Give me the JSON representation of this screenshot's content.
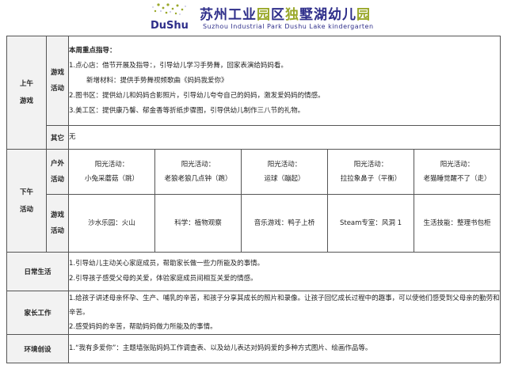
{
  "header": {
    "logo_text": "DuShu",
    "title_part1": "苏州工业",
    "title_hl1": "园",
    "title_part2": "区",
    "title_hl2": "独",
    "title_part3": "墅湖幼儿",
    "title_hl3": "园",
    "subtitle": "Suzhou Industrial Park Dushu Lake kindergarten"
  },
  "morning": {
    "label_line1": "上午",
    "label_line2": "游戏",
    "game_label_line1": "游戏",
    "game_label_line2": "活动",
    "heading": "本周重点指导：",
    "lines": [
      "1.点心店：借节开展及指导：，引导幼儿学习手势舞，回家表演给妈妈看。",
      "新增材料：提供手势舞视频歌曲《妈妈我爱你》",
      "2.图书区：提供幼儿和妈妈合影照片，引导幼儿夸夸自己的妈妈，激发爱妈妈的情感。",
      "3.美工区：提供康乃馨、郁金香等折纸步骤图，引导供幼儿制作三八节的礼物。"
    ],
    "other_label": "其它",
    "other_value": "无"
  },
  "afternoon": {
    "label_line1": "下午",
    "label_line2": "活动",
    "outdoor_label_line1": "户外",
    "outdoor_label_line2": "活动",
    "outdoor": [
      {
        "title": "阳光活动：",
        "name": "小兔采蘑菇（跳）"
      },
      {
        "title": "阳光活动：",
        "name": "老狼老狼几点钟（跑）"
      },
      {
        "title": "阳光活动：",
        "name": "运球（蹦起）"
      },
      {
        "title": "阳光活动：",
        "name": "拉拉象鼻子（平衡）"
      },
      {
        "title": "阳光活动：",
        "name": "老猫睡觉醒不了（走）"
      }
    ],
    "game_label_line1": "游戏",
    "game_label_line2": "活动",
    "games": [
      "沙水乐园：火山",
      "科学：植物观察",
      "音乐游戏：鸭子上桥",
      "Steam专室：风洞 1",
      "生活技能：整理书包柜"
    ]
  },
  "daily": {
    "label": "日常生活",
    "lines": [
      "1.引导幼儿主动关心家庭成员，帮助家长做一些力所能及的事情。",
      "2.引导孩子感受父母的关爱，体验家庭成员间相互关爱的情感。"
    ]
  },
  "parents": {
    "label": "家长工作",
    "lines": [
      "1.给孩子讲述母亲怀孕、生产、哺乳的辛苦，和孩子分享其成长的照片和录像。让孩子回忆成长过程中的趣事，可以使他们感受到父母亲的勤劳和辛苦。",
      "2.感受妈妈的辛苦，帮助妈妈做力所能及的事情。"
    ]
  },
  "environment": {
    "label": "环境创设",
    "text": "1.“我有多爱你”：主题墙张贴妈妈工作调查表、以及幼儿表达对妈妈爱的多种方式图片、绘画作品等。"
  },
  "colors": {
    "brand_blue": "#2e2e8a",
    "brand_green": "#9aa82a",
    "label_shade": "#f2f2f2"
  }
}
